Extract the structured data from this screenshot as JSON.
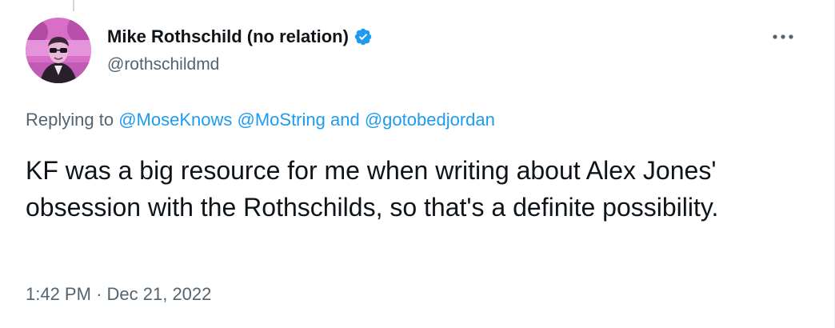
{
  "tweet": {
    "author": {
      "display_name": "Mike Rothschild (no relation)",
      "handle": "@rothschildmd",
      "verified": true
    },
    "replying": {
      "prefix": "Replying to",
      "mentions": [
        "@MoseKnows",
        "@MoString",
        "@gotobedjordan"
      ],
      "separator": "and"
    },
    "text": "KF was a big resource for me when writing about Alex Jones' obsession with the Rothschilds, so that's a definite possibility.",
    "time": "1:42 PM",
    "dot": "·",
    "date": "Dec 21, 2022"
  },
  "icons": {
    "verified": "verified-badge-icon",
    "more": "more-options-icon"
  },
  "colors": {
    "accent": "#1d9bf0",
    "text_primary": "#0f1419",
    "text_secondary": "#536471",
    "avatar_tint": "#e86fd6"
  }
}
